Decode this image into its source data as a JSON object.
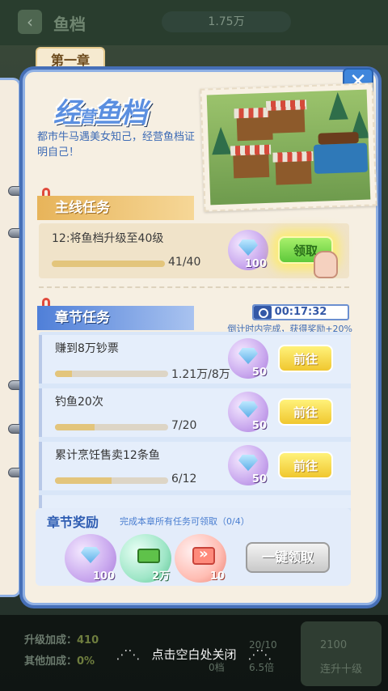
{
  "background": {
    "title": "鱼档",
    "money": "1.75万",
    "stats": [
      {
        "label": "升级加成：",
        "value": "410"
      },
      {
        "label": "其他加成：",
        "value": "0%"
      }
    ],
    "mid_values": [
      "20/10",
      "6.5倍",
      "0档"
    ],
    "right_values": [
      "2100",
      "连升十级"
    ]
  },
  "modal": {
    "chapter_tab": "第一章",
    "logo": {
      "part1": "经",
      "part2": "营",
      "part3": "鱼档"
    },
    "description": "都市牛马遇美女知己，经营鱼档证明自己！",
    "main_section": {
      "label": "主线任务",
      "task": {
        "title": "12:将鱼档升级至40级",
        "progress_text": "41/40",
        "progress": 1.0,
        "reward": "100",
        "button": "领取"
      }
    },
    "chapter_section": {
      "label": "章节任务",
      "timer": "00:17:32",
      "timer_note": "倒计时内完成，获得奖励+20%",
      "tasks": [
        {
          "title": "赚到8万钞票",
          "progress_text": "1.21万/8万",
          "progress": 0.15,
          "reward": "50",
          "button": "前往"
        },
        {
          "title": "钓鱼20次",
          "progress_text": "7/20",
          "progress": 0.35,
          "reward": "50",
          "button": "前往"
        },
        {
          "title": "累计烹饪售卖12条鱼",
          "progress_text": "6/12",
          "progress": 0.5,
          "reward": "50",
          "button": "前往"
        }
      ]
    },
    "reward_section": {
      "label": "章节奖励",
      "note": "完成本章所有任务可领取（0/4）",
      "items": [
        {
          "icon": "gem-icon",
          "value": "100"
        },
        {
          "icon": "cash-icon",
          "value": "2万"
        },
        {
          "icon": "speed-ticket-icon",
          "value": "10"
        }
      ],
      "button": "一键领取"
    }
  },
  "hint": "点击空白处关闭",
  "colors": {
    "accent_blue": "#3f86dc",
    "gold": "#e7b45a",
    "green": "#5ec93b"
  }
}
